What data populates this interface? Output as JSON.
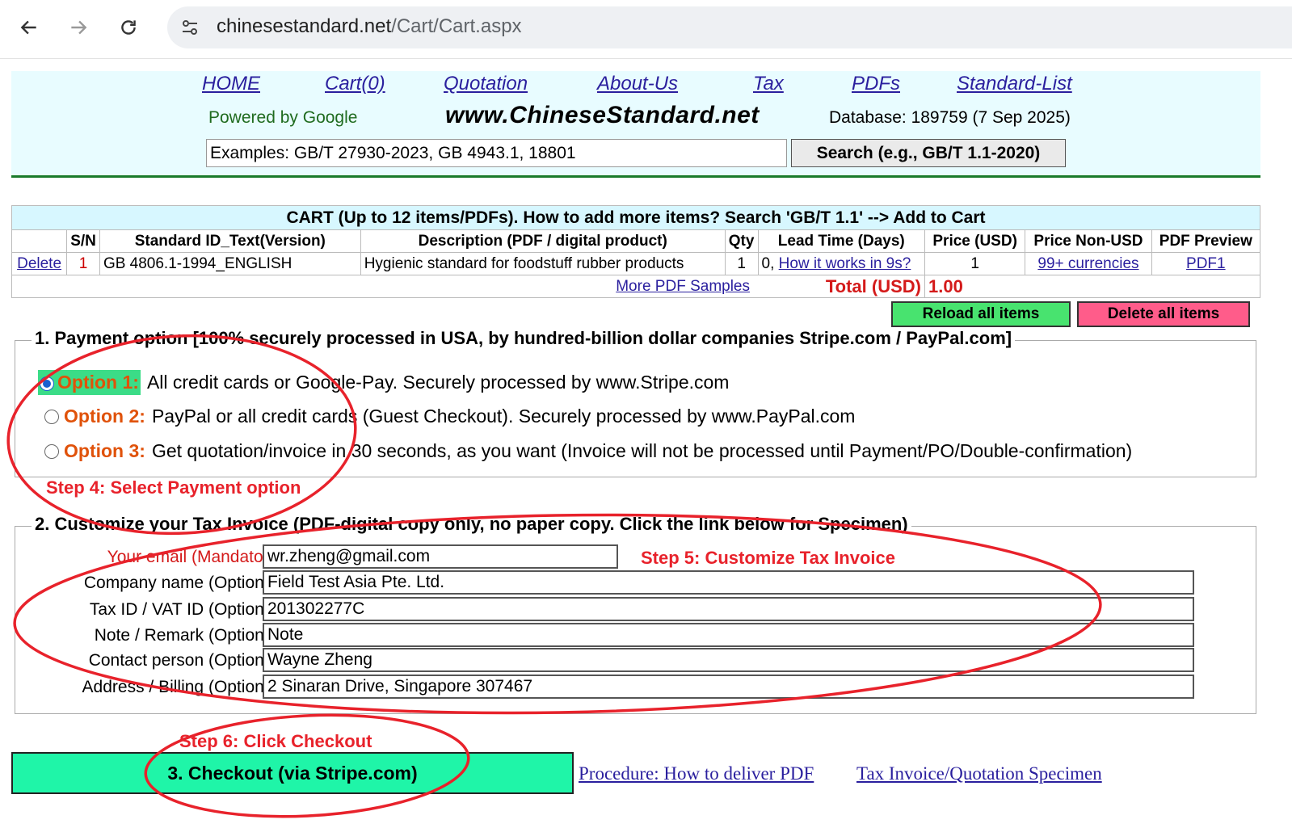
{
  "browser": {
    "url_host": "chinesestandard.net",
    "url_path": "/Cart/Cart.aspx",
    "back_icon": "back-arrow-icon",
    "forward_icon": "forward-arrow-icon",
    "reload_icon": "reload-icon",
    "site_info_icon": "tune-icon"
  },
  "header": {
    "menu": [
      "HOME",
      "Cart(0)",
      "Quotation",
      "About-Us",
      "Tax",
      "PDFs",
      "Standard-List"
    ],
    "powered": "Powered by Google",
    "site": "www.ChineseStandard.net",
    "database": "Database: 189759 (7 Sep 2025)",
    "search_value": "Examples: GB/T 27930-2023, GB 4943.1, 18801",
    "search_button": "Search (e.g., GB/T 1.1-2020)"
  },
  "cart": {
    "caption": "CART (Up to 12 items/PDFs). How to add more items? Search 'GB/T 1.1' --> Add to Cart",
    "headers": [
      "",
      "S/N",
      "Standard ID_Text(Version)",
      "Description (PDF / digital product)",
      "Qty",
      "Lead Time (Days)",
      "Price (USD)",
      "Price Non-USD",
      "PDF Preview"
    ],
    "row": {
      "delete": "Delete",
      "sn": "1",
      "id": "GB 4806.1-1994_ENGLISH",
      "description": "Hygienic standard for foodstuff rubber products",
      "qty": "1",
      "lead_prefix": "0, ",
      "lead_link": "How it works in 9s?",
      "price": "1",
      "non_usd": "99+ currencies",
      "preview": "PDF1"
    },
    "more_samples": "More PDF Samples",
    "total_label": "Total (USD)",
    "total_value": "1.00",
    "reload_button": "Reload all items",
    "delete_all_button": "Delete all items"
  },
  "payment": {
    "legend": "1. Payment option [100% securely processed in USA, by hundred-billion dollar companies Stripe.com / PayPal.com]",
    "options": [
      {
        "label": "Option 1:",
        "text": "All credit cards or Google-Pay. Securely processed by www.Stripe.com",
        "selected": true
      },
      {
        "label": "Option 2:",
        "text": "PayPal or all credit cards (Guest Checkout). Securely processed by www.PayPal.com",
        "selected": false
      },
      {
        "label": "Option 3:",
        "text": "Get quotation/invoice in 30 seconds, as you want (Invoice will not be processed until Payment/PO/Double-confirmation)",
        "selected": false
      }
    ]
  },
  "invoice": {
    "legend": "2. Customize your Tax Invoice (PDF-digital copy only, no paper copy. Click the link below for Specimen)",
    "fields": [
      {
        "label": "Your email (Mandatory):",
        "value": "wr.zheng@gmail.com"
      },
      {
        "label": "Company name (Optional):",
        "value": "Field Test Asia Pte. Ltd."
      },
      {
        "label": "Tax ID / VAT ID (Optional):",
        "value": "201302277C"
      },
      {
        "label": "Note / Remark (Optional):",
        "value": "Note"
      },
      {
        "label": "Contact person (Optional):",
        "value": "Wayne Zheng"
      },
      {
        "label": "Address / Billing (Optional):",
        "value": "2 Sinaran Drive, Singapore 307467"
      }
    ]
  },
  "checkout": {
    "button": "3. Checkout (via Stripe.com)",
    "procedure_link": "Procedure: How to deliver PDF",
    "specimen_link": "Tax Invoice/Quotation Specimen"
  },
  "annotations": {
    "step4": "Step 4: Select Payment option",
    "step5": "Step 5: Customize Tax Invoice",
    "step6": "Step 6: Click Checkout"
  },
  "colors": {
    "header_bg": "#e8fcff",
    "link": "#2a1f9e",
    "annotation": "#e8222b",
    "checkout_bg": "#1ff5a8",
    "reload_bg": "#48e36f",
    "delete_bg": "#ff5c8a"
  }
}
